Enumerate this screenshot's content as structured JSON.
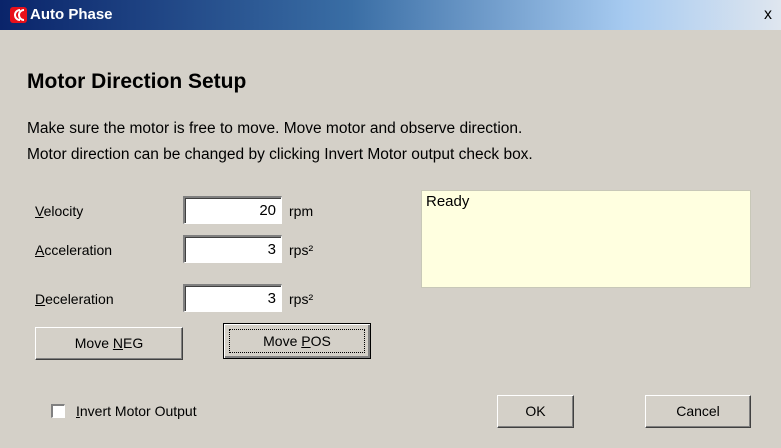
{
  "window": {
    "title": "Auto Phase",
    "close_glyph": "x"
  },
  "main": {
    "heading": "Motor Direction Setup",
    "instruction_line1": "Make sure the motor is free to move.  Move motor and observe direction.",
    "instruction_line2": "Motor direction can be changed by clicking Invert Motor output check box."
  },
  "fields": {
    "velocity": {
      "label_accel_char": "V",
      "label_rest": "elocity",
      "value": "20",
      "unit": "rpm"
    },
    "acceleration": {
      "label_accel_char": "A",
      "label_rest": "cceleration",
      "value": "3",
      "unit": "rps²"
    },
    "deceleration": {
      "label_accel_char": "D",
      "label_rest": "eceleration",
      "value": "3",
      "unit": "rps²"
    }
  },
  "status": {
    "text": "Ready",
    "background": "#ffffe0"
  },
  "buttons": {
    "move_neg": {
      "prefix": "Move ",
      "accel_char": "N",
      "suffix": "EG"
    },
    "move_pos": {
      "prefix": "Move ",
      "accel_char": "P",
      "suffix": "OS"
    },
    "ok": "OK",
    "cancel": "Cancel"
  },
  "invert": {
    "accel_char": "I",
    "label_rest": "nvert Motor Output",
    "checked": false
  },
  "colors": {
    "dialog_bg": "#d4d0c8",
    "titlebar_start": "#0a246a",
    "app_icon": "#e8101a"
  }
}
